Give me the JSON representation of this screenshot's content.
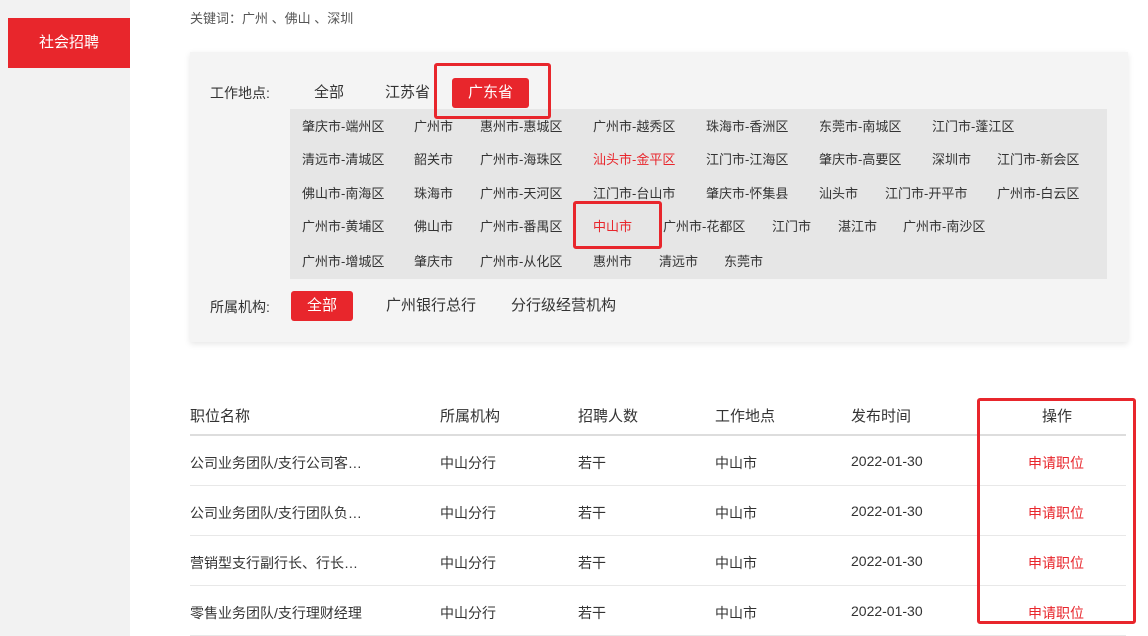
{
  "sidebar": {
    "items": [
      {
        "label": "社会招聘",
        "active": true
      }
    ]
  },
  "keywords_line": "关键词：广州 、佛山 、深圳",
  "filters": {
    "location_label": "工作地点:",
    "provinces": [
      {
        "label": "全部"
      },
      {
        "label": "江苏省"
      },
      {
        "label": "广东省",
        "selected": true
      }
    ],
    "cities": [
      [
        "肇庆市-端州区",
        "广州市",
        "惠州市-惠城区",
        "广州市-越秀区",
        "珠海市-香洲区",
        "东莞市-南城区",
        "江门市-蓬江区"
      ],
      [
        "清远市-清城区",
        "韶关市",
        "广州市-海珠区",
        "汕头市-金平区",
        "江门市-江海区",
        "肇庆市-高要区",
        "深圳市",
        "江门市-新会区"
      ],
      [
        "佛山市-南海区",
        "珠海市",
        "广州市-天河区",
        "江门市-台山市",
        "肇庆市-怀集县",
        "汕头市",
        "江门市-开平市",
        "广州市-白云区"
      ],
      [
        "广州市-黄埔区",
        "佛山市",
        "广州市-番禺区",
        "中山市",
        "广州市-花都区",
        "江门市",
        "湛江市",
        "广州市-南沙区"
      ],
      [
        "广州市-增城区",
        "肇庆市",
        "广州市-从化区",
        "惠州市",
        "清远市",
        "东莞市"
      ]
    ],
    "highlighted_cities": [
      "汕头市-金平区",
      "中山市"
    ],
    "org_label": "所属机构:",
    "orgs": [
      {
        "label": "全部",
        "selected": true
      },
      {
        "label": "广州银行总行"
      },
      {
        "label": "分行级经营机构"
      }
    ]
  },
  "table": {
    "headers": [
      "职位名称",
      "所属机构",
      "招聘人数",
      "工作地点",
      "发布时间",
      "操作"
    ],
    "rows": [
      {
        "title": "公司业务团队/支行公司客…",
        "org": "中山分行",
        "count": "若干",
        "location": "中山市",
        "date": "2022-01-30",
        "action": "申请职位"
      },
      {
        "title": "公司业务团队/支行团队负…",
        "org": "中山分行",
        "count": "若干",
        "location": "中山市",
        "date": "2022-01-30",
        "action": "申请职位"
      },
      {
        "title": "营销型支行副行长、行长…",
        "org": "中山分行",
        "count": "若干",
        "location": "中山市",
        "date": "2022-01-30",
        "action": "申请职位"
      },
      {
        "title": "零售业务团队/支行理财经理",
        "org": "中山分行",
        "count": "若干",
        "location": "中山市",
        "date": "2022-01-30",
        "action": "申请职位"
      }
    ]
  },
  "colors": {
    "accent": "#e8262c",
    "panel_bg": "#f4f4f4",
    "city_box_bg": "#e6e6e6",
    "sidebar_bg": "#f2f2f2"
  }
}
